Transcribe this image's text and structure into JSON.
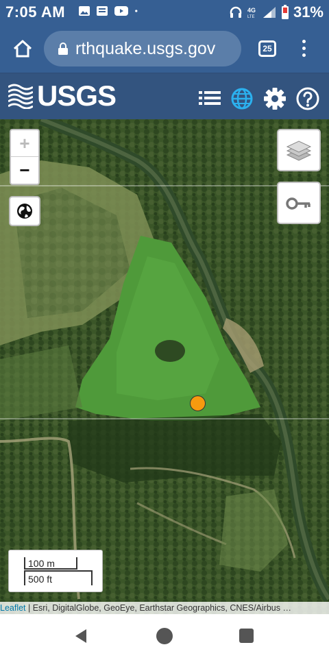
{
  "status_bar": {
    "time": "7:05 AM",
    "battery": "31%",
    "network": "4G",
    "icons": [
      "image-icon",
      "news-icon",
      "youtube-icon",
      "dot-icon",
      "headset-icon",
      "network-4g-icon",
      "signal-icon",
      "battery-icon"
    ]
  },
  "browser": {
    "url": "rthquake.usgs.gov",
    "tab_count": "25",
    "icons": [
      "home-icon",
      "lock-icon",
      "menu-dots-icon"
    ]
  },
  "header": {
    "logo": "USGS",
    "icons": [
      "list-icon",
      "globe-icon",
      "gear-icon",
      "help-icon"
    ],
    "accent_color": "#2bb1ef",
    "bar_color": "#33547f"
  },
  "map": {
    "zoom_in": "+",
    "zoom_out": "−",
    "scale_metric": "100 m",
    "scale_imperial": "500 ft",
    "attribution_link": "Leaflet",
    "attribution_text": " | Esri, DigitalGlobe, GeoEye, Earthstar Geographics, CNES/Airbus …",
    "marker_color": "#f79a0f",
    "controls": [
      "globe-icon",
      "layers-icon",
      "key-icon"
    ]
  },
  "nav": {
    "icons": [
      "back-icon",
      "home-circle-icon",
      "recents-icon"
    ]
  }
}
